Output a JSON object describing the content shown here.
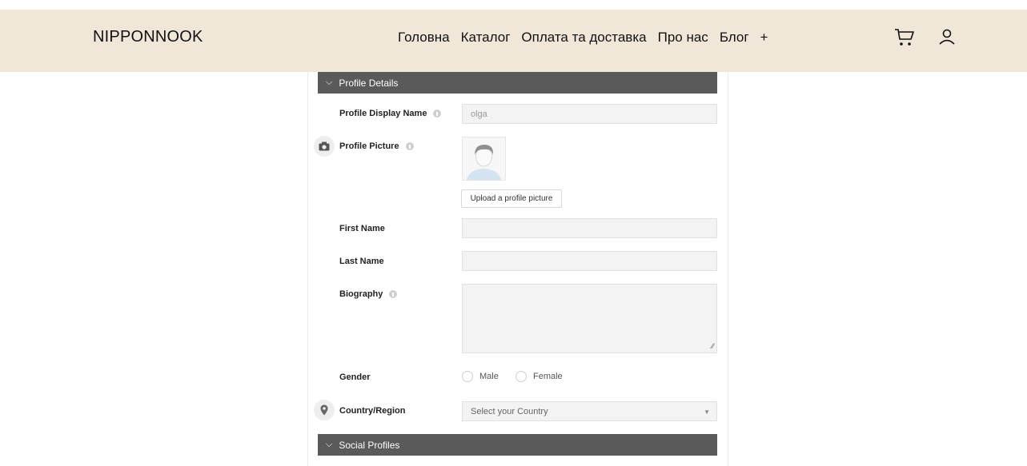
{
  "header": {
    "brand": "NIPPONNOOK",
    "nav": [
      "Головна",
      "Каталог",
      "Оплата та доставка",
      "Про нас",
      "Блог",
      "+"
    ],
    "icons": [
      "cart-icon",
      "user-icon"
    ],
    "background": "#f1e7d9"
  },
  "sections": {
    "profile_details": "Profile Details",
    "social_profiles": "Social Profiles"
  },
  "form": {
    "display_name_label": "Profile Display Name",
    "display_name_value": "olga",
    "picture_label": "Profile Picture",
    "upload_label": "Upload a profile picture",
    "first_name_label": "First Name",
    "first_name_value": "",
    "last_name_label": "Last Name",
    "last_name_value": "",
    "biography_label": "Biography",
    "biography_value": "",
    "gender_label": "Gender",
    "gender_options": [
      "Male",
      "Female"
    ],
    "country_label": "Country/Region",
    "country_placeholder": "Select your Country"
  },
  "colors": {
    "section_bar": "#5a5a5a",
    "field_bg": "#f3f3f3"
  }
}
